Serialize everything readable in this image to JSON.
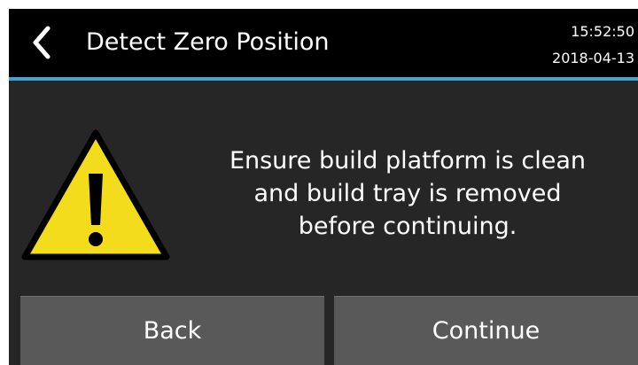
{
  "header": {
    "title": "Detect Zero Position",
    "time": "15:52:50",
    "date": "2018-04-13",
    "back_icon": "chevron-left-icon"
  },
  "main": {
    "warning_icon": "warning-triangle-icon",
    "message": "Ensure build platform is clean\nand build tray is removed\nbefore continuing."
  },
  "buttons": {
    "back_label": "Back",
    "continue_label": "Continue"
  },
  "colors": {
    "background": "#262626",
    "header_background": "#000000",
    "accent": "#3aa5d6",
    "button_background": "#595959",
    "warning_yellow": "#f2dc1b"
  }
}
